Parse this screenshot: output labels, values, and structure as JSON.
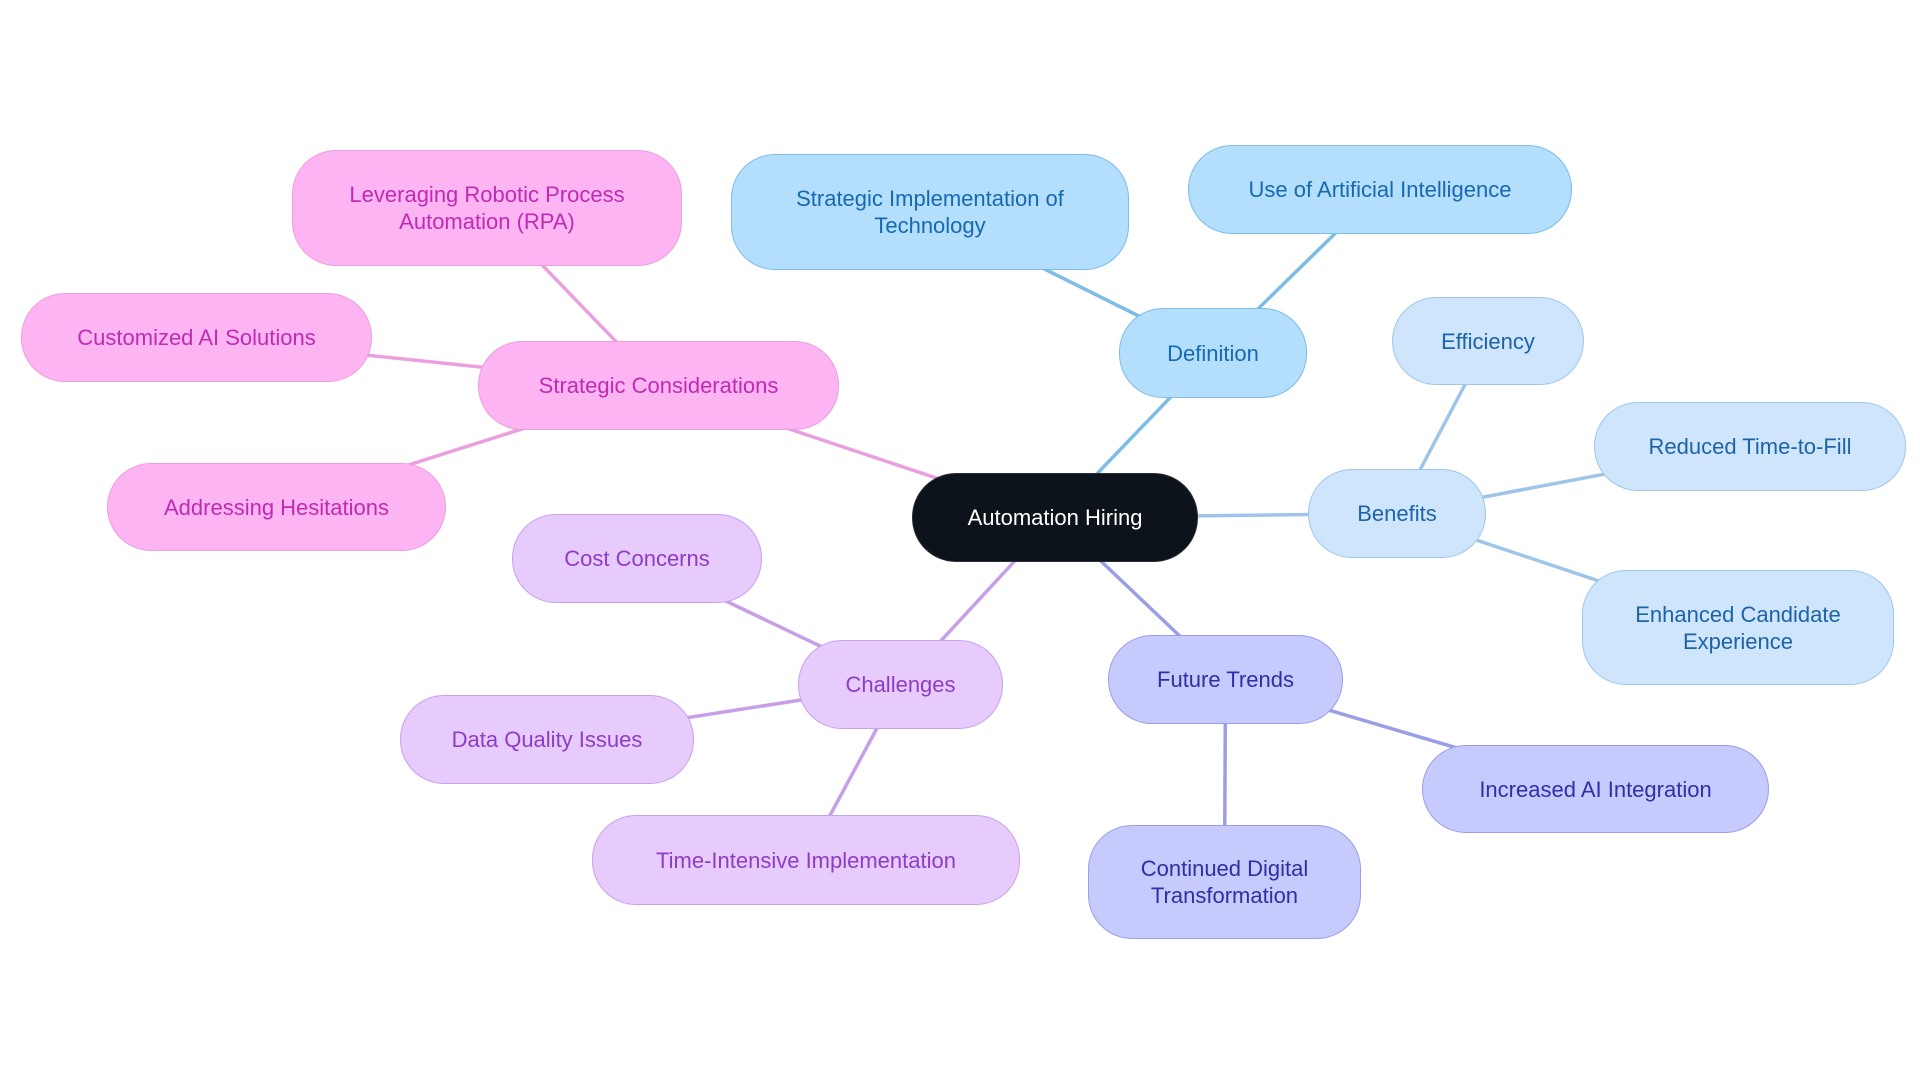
{
  "root": {
    "label": "Automation Hiring"
  },
  "branches": [
    {
      "key": "definition",
      "label": "Definition",
      "edge_color": "#7bbde6",
      "children": [
        {
          "label": "Strategic Implementation of\nTechnology"
        },
        {
          "label": "Use of Artificial Intelligence"
        }
      ]
    },
    {
      "key": "benefits",
      "label": "Benefits",
      "edge_color": "#9ec4ea",
      "children": [
        {
          "label": "Efficiency"
        },
        {
          "label": "Reduced Time-to-Fill"
        },
        {
          "label": "Enhanced Candidate\nExperience"
        }
      ]
    },
    {
      "key": "future_trends",
      "label": "Future Trends",
      "edge_color": "#9a9ee6",
      "children": [
        {
          "label": "Increased AI Integration"
        },
        {
          "label": "Continued Digital\nTransformation"
        }
      ]
    },
    {
      "key": "challenges",
      "label": "Challenges",
      "edge_color": "#c79fe8",
      "children": [
        {
          "label": "Cost Concerns"
        },
        {
          "label": "Data Quality Issues"
        },
        {
          "label": "Time-Intensive Implementation"
        }
      ]
    },
    {
      "key": "strategic_considerations",
      "label": "Strategic Considerations",
      "edge_color": "#ea9fdf",
      "children": [
        {
          "label": "Leveraging Robotic Process\nAutomation (RPA)"
        },
        {
          "label": "Customized AI Solutions"
        },
        {
          "label": "Addressing Hesitations"
        }
      ]
    }
  ]
}
